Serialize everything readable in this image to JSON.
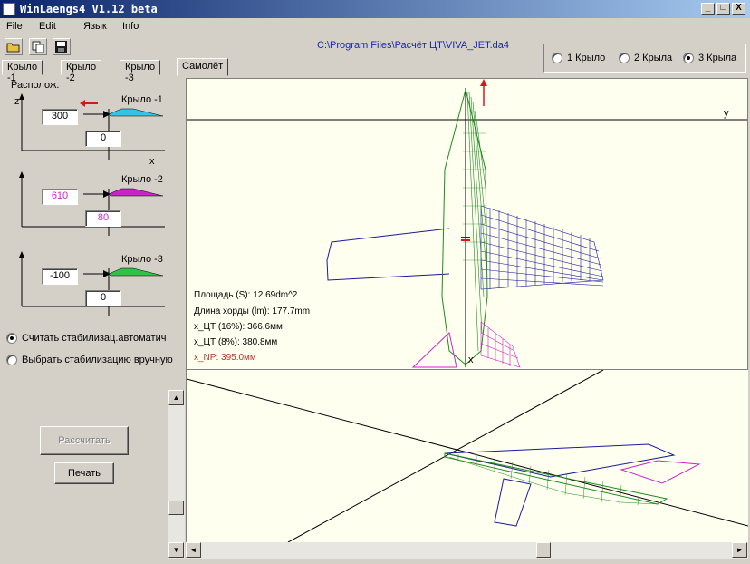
{
  "window": {
    "title": "WinLaengs4 V1.12 beta",
    "min": "_",
    "max": "□",
    "close": "X"
  },
  "menu": [
    "File",
    "Edit",
    "Язык",
    "Info"
  ],
  "file_path": "C:\\Program Files\\Расчёт ЦТ\\VIVA_JET.da4",
  "wing_count": {
    "options": [
      "1 Крыло",
      "2 Крыла",
      "3 Крыла"
    ],
    "selected": 2
  },
  "tabs": [
    "Крыло -1",
    "Крыло -2",
    "Крыло -3",
    "Самолёт"
  ],
  "active_tab": 3,
  "position": {
    "label": "Располож.",
    "axis_z": "z",
    "axis_x": "x",
    "wings": [
      {
        "label": "Крыло -1",
        "z": "300",
        "x": "0",
        "color": "#33c3e8"
      },
      {
        "label": "Крыло -2",
        "z": "610",
        "x": "80",
        "color": "#cc22cc"
      },
      {
        "label": "Крыло -3",
        "z": "-100",
        "x": "0",
        "color": "#2ec24a"
      }
    ]
  },
  "stabilizer": {
    "auto": "Считать стабилизац.автоматич",
    "manual": "Выбрать стабилизацию вручную",
    "selected": "auto"
  },
  "buttons": {
    "calculate": "Рассчитать",
    "print": "Печать"
  },
  "top_view": {
    "axis_y": "y",
    "axis_x": "x",
    "area": "Площадь     (S): 12.69dm^2",
    "chord": "Длина хорды (lm): 177.7mm",
    "cg16": "x_ЦТ (16%): 366.6мм",
    "cg8": "x_ЦТ (8%): 380.8мм",
    "np": "x_NP: 395.0мм"
  },
  "colors": {
    "wing": "#1a1a9a",
    "fuselage": "#1e8a1e",
    "tail": "#cc22cc",
    "np": "#b03a2e",
    "arrow": "#d21a1a"
  }
}
